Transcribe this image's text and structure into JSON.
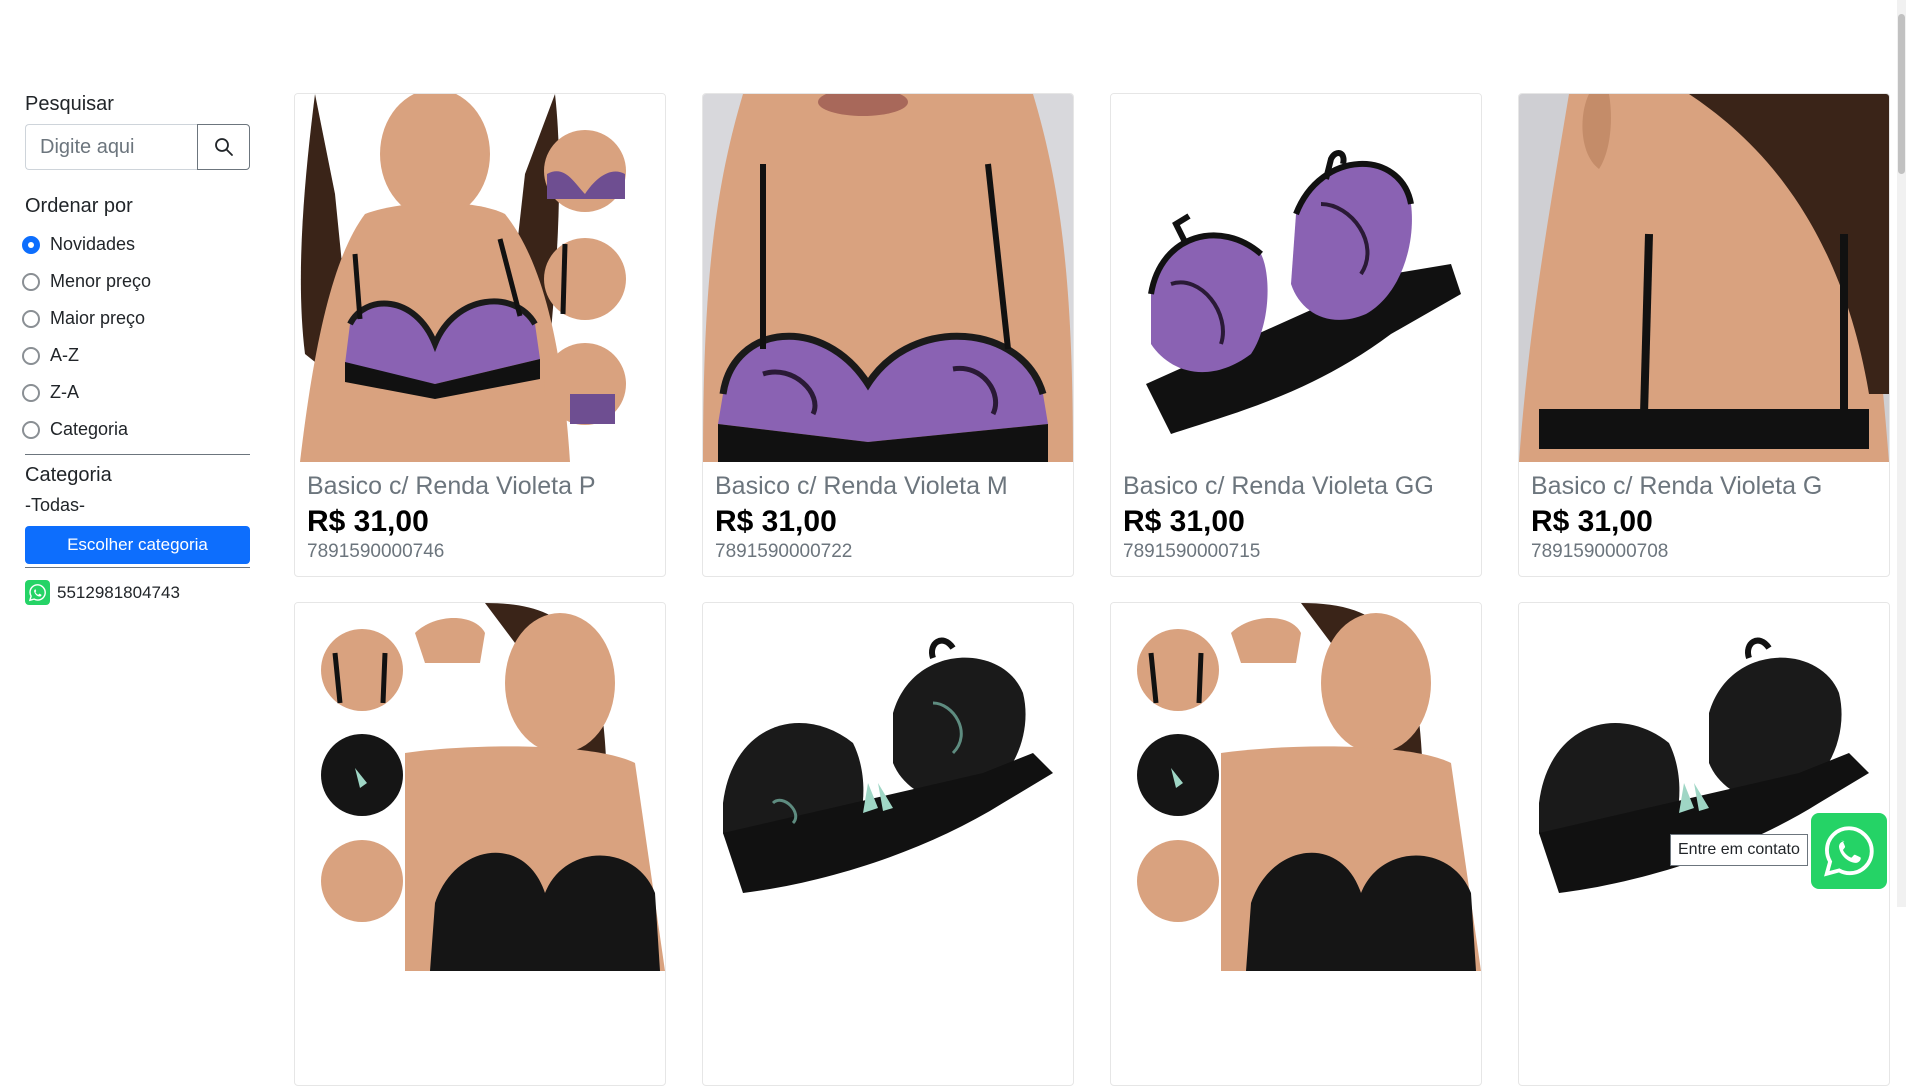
{
  "sidebar": {
    "search_label": "Pesquisar",
    "search_placeholder": "Digite aqui",
    "sort_label": "Ordenar por",
    "sort_options": [
      "Novidades",
      "Menor preço",
      "Maior preço",
      "A-Z",
      "Z-A",
      "Categoria"
    ],
    "sort_selected": "Novidades",
    "category_label": "Categoria",
    "category_value": "-Todas-",
    "category_button": "Escolher categoria",
    "whatsapp_number": "5512981804743"
  },
  "products": [
    {
      "name": "Basico c/ Renda Violeta P",
      "price": "R$ 31,00",
      "code": "7891590000746"
    },
    {
      "name": "Basico c/ Renda Violeta M",
      "price": "R$ 31,00",
      "code": "7891590000722"
    },
    {
      "name": "Basico c/ Renda Violeta GG",
      "price": "R$ 31,00",
      "code": "7891590000715"
    },
    {
      "name": "Basico c/ Renda Violeta G",
      "price": "R$ 31,00",
      "code": "7891590000708"
    }
  ],
  "contact_tooltip": "Entre em contato",
  "colors": {
    "primary": "#0d6efd",
    "whatsapp": "#25d366",
    "violet": "#8a62b3"
  }
}
